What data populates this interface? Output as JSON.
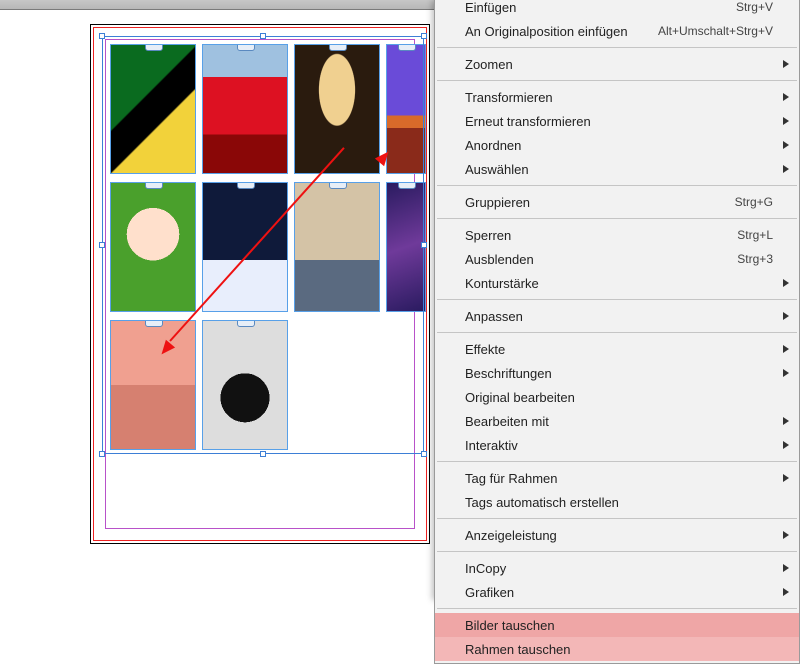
{
  "menu": {
    "einfugen": {
      "label": "Einfügen",
      "shortcut": "Strg+V"
    },
    "original_pos": {
      "label": "An Originalposition einfügen",
      "shortcut": "Alt+Umschalt+Strg+V"
    },
    "zoomen": {
      "label": "Zoomen"
    },
    "transformieren": {
      "label": "Transformieren"
    },
    "erneut": {
      "label": "Erneut transformieren"
    },
    "anordnen": {
      "label": "Anordnen"
    },
    "auswahlen": {
      "label": "Auswählen"
    },
    "gruppieren": {
      "label": "Gruppieren",
      "shortcut": "Strg+G"
    },
    "sperren": {
      "label": "Sperren",
      "shortcut": "Strg+L"
    },
    "ausblenden": {
      "label": "Ausblenden",
      "shortcut": "Strg+3"
    },
    "konturstarke": {
      "label": "Konturstärke"
    },
    "anpassen": {
      "label": "Anpassen"
    },
    "effekte": {
      "label": "Effekte"
    },
    "beschriftungen": {
      "label": "Beschriftungen"
    },
    "original_bearbeiten": {
      "label": "Original bearbeiten"
    },
    "bearbeiten_mit": {
      "label": "Bearbeiten mit"
    },
    "interaktiv": {
      "label": "Interaktiv"
    },
    "tag_rahmen": {
      "label": "Tag für Rahmen"
    },
    "tags_auto": {
      "label": "Tags automatisch erstellen"
    },
    "anzeigeleistung": {
      "label": "Anzeigeleistung"
    },
    "incopy": {
      "label": "InCopy"
    },
    "grafiken": {
      "label": "Grafiken"
    },
    "bilder_tauschen": {
      "label": "Bilder tauschen"
    },
    "rahmen_tauschen": {
      "label": "Rahmen tauschen"
    }
  },
  "frames": {
    "f1": "toucan",
    "f2": "woman-car",
    "f3": "blonde",
    "f4": "sunset",
    "f5": "baby",
    "f6": "snowhouse",
    "f7": "cat",
    "f8": "drums",
    "f9": "elephant",
    "f10": "motorbike"
  }
}
